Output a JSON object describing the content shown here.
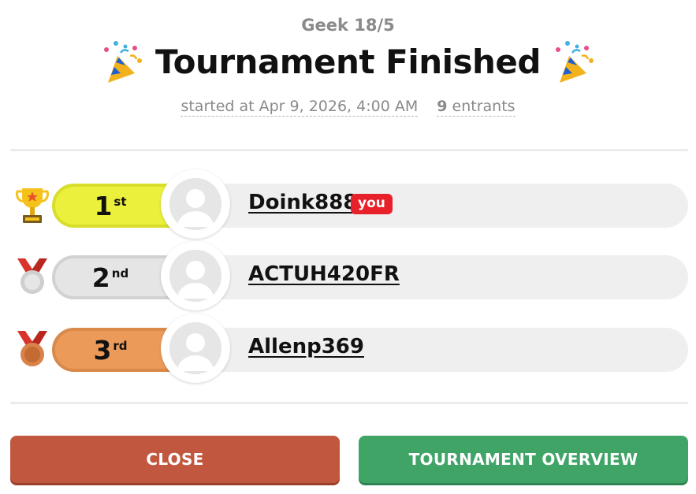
{
  "header": {
    "subtitle": "Geek 18/5",
    "title": "Tournament Finished",
    "started_label": "started at Apr 9, 2026, 4:00 AM",
    "entrants_count": "9",
    "entrants_label": "entrants"
  },
  "standings": [
    {
      "place": "1",
      "suffix": "st",
      "name": "Doink888",
      "badge": "you",
      "award_icon": "trophy-icon",
      "color": "#eaf03c",
      "border": "#d8de2a"
    },
    {
      "place": "2",
      "suffix": "nd",
      "name": "ACTUH420FR",
      "badge": "",
      "award_icon": "silver-medal-icon",
      "color": "#e5e5e5",
      "border": "#d2d2d2"
    },
    {
      "place": "3",
      "suffix": "rd",
      "name": "Allenp369",
      "badge": "",
      "award_icon": "bronze-medal-icon",
      "color": "#eb9a5a",
      "border": "#d9894a"
    }
  ],
  "actions": {
    "close_label": "CLOSE",
    "overview_label": "TOURNAMENT OVERVIEW"
  },
  "colors": {
    "close": "#c1573f",
    "overview": "#3fa466",
    "you_badge": "#e8202a"
  }
}
